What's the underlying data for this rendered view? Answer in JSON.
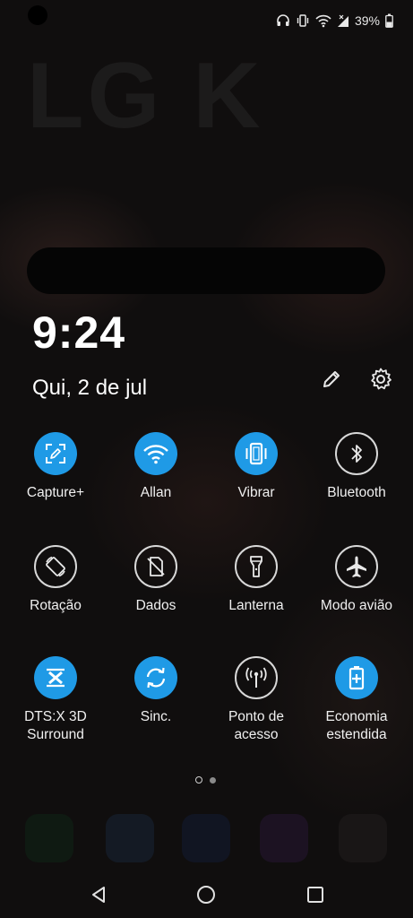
{
  "wallpaper": {
    "brand_text": "LG K"
  },
  "status_bar": {
    "icons": [
      "headset-icon",
      "vibrate-icon",
      "wifi-icon",
      "signal-icon",
      "battery-icon"
    ],
    "battery_text": "39%"
  },
  "clock": {
    "time": "9:24",
    "date": "Qui, 2 de jul"
  },
  "header": {
    "edit_icon": "pencil-icon",
    "settings_icon": "gear-icon"
  },
  "tiles": [
    {
      "label": "Capture+",
      "icon": "capture-plus-icon",
      "state": "on"
    },
    {
      "label": "Allan",
      "icon": "wifi-icon",
      "state": "on"
    },
    {
      "label": "Vibrar",
      "icon": "vibrate-icon",
      "state": "on"
    },
    {
      "label": "Bluetooth",
      "icon": "bluetooth-icon",
      "state": "off"
    },
    {
      "label": "Rotação",
      "icon": "rotation-icon",
      "state": "off"
    },
    {
      "label": "Dados",
      "icon": "mobile-data-off-icon",
      "state": "off"
    },
    {
      "label": "Lanterna",
      "icon": "flashlight-icon",
      "state": "off"
    },
    {
      "label": "Modo avião",
      "icon": "airplane-icon",
      "state": "off"
    },
    {
      "label_line1": "DTS:X 3D",
      "label_line2": "Surround",
      "icon": "dtsx-icon",
      "state": "on"
    },
    {
      "label": "Sinc.",
      "icon": "sync-icon",
      "state": "on"
    },
    {
      "label_line1": "Ponto de",
      "label_line2": "acesso",
      "icon": "hotspot-icon",
      "state": "off"
    },
    {
      "label_line1": "Economia",
      "label_line2": "estendida",
      "icon": "battery-saver-icon",
      "state": "on"
    }
  ],
  "pager": {
    "pages": 2,
    "current": 1
  },
  "nav": {
    "back": "back-icon",
    "home": "home-icon",
    "recents": "recents-icon"
  },
  "colors": {
    "accent": "#1f9ae6",
    "background": "#0e0d0d"
  }
}
